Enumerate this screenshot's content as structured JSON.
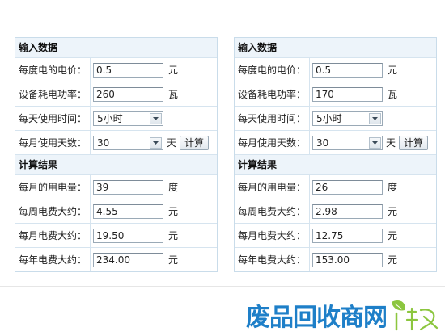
{
  "panels": [
    {
      "input_title": "输入数据",
      "price_label": "每度电的电价：",
      "price_value": "0.5",
      "price_unit": "元",
      "power_label": "设备耗电功率：",
      "power_value": "260",
      "power_unit": "瓦",
      "hours_label": "每天使用时间：",
      "hours_value": "5小时",
      "days_label": "每月使用天数：",
      "days_value": "30",
      "days_unit": "天",
      "calc_button": "计算",
      "result_title": "计算结果",
      "usage_label": "每月的用电量：",
      "usage_value": "39",
      "usage_unit": "度",
      "week_label": "每周电费大约：",
      "week_value": "4.55",
      "week_unit": "元",
      "month_label": "每月电费大约：",
      "month_value": "19.50",
      "month_unit": "元",
      "year_label": "每年电费大约：",
      "year_value": "234.00",
      "year_unit": "元"
    },
    {
      "input_title": "输入数据",
      "price_label": "每度电的电价：",
      "price_value": "0.5",
      "price_unit": "元",
      "power_label": "设备耗电功率：",
      "power_value": "170",
      "power_unit": "瓦",
      "hours_label": "每天使用时间：",
      "hours_value": "5小时",
      "days_label": "每月使用天数：",
      "days_value": "30",
      "days_unit": "天",
      "calc_button": "计算",
      "result_title": "计算结果",
      "usage_label": "每月的用电量：",
      "usage_value": "26",
      "usage_unit": "度",
      "week_label": "每周电费大约：",
      "week_value": "2.98",
      "week_unit": "元",
      "month_label": "每月电费大约：",
      "month_value": "12.75",
      "month_unit": "元",
      "year_label": "每年电费大约：",
      "year_value": "153.00",
      "year_unit": "元"
    }
  ],
  "watermark": {
    "text": "废品回收商网",
    "colors": {
      "main": "#1e7fc8",
      "leaf": "#8cc63f",
      "accent": "#8cc63f"
    }
  },
  "colors": {
    "border": "#c9dcea",
    "section_header_bg": "#edf4fa",
    "divider": "#d6e4ef"
  }
}
